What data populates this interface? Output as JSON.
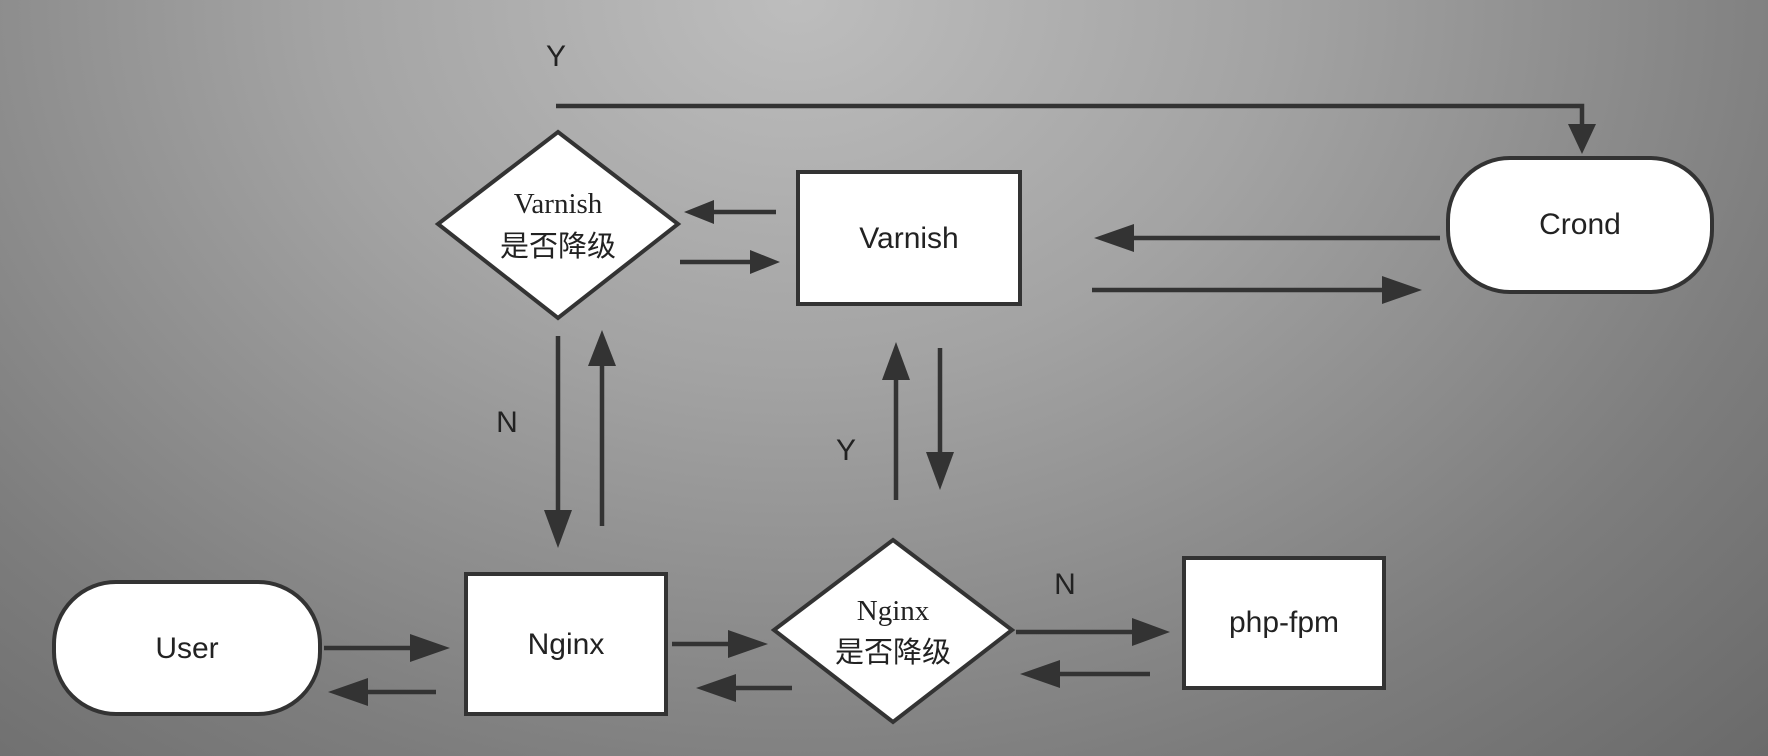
{
  "nodes": {
    "user": {
      "label": "User"
    },
    "nginx": {
      "label": "Nginx"
    },
    "nginx_decision": {
      "line1": "Nginx",
      "line2": "是否降级"
    },
    "php_fpm": {
      "label": "php-fpm"
    },
    "varnish": {
      "label": "Varnish"
    },
    "varnish_decision": {
      "line1": "Varnish",
      "line2": "是否降级"
    },
    "crond": {
      "label": "Crond"
    }
  },
  "edge_labels": {
    "top_y": "Y",
    "varnish_n": "N",
    "nginx_y": "Y",
    "nginx_n": "N"
  },
  "colors": {
    "shape_fill": "#ffffff",
    "stroke": "#333333",
    "text": "#222222"
  }
}
